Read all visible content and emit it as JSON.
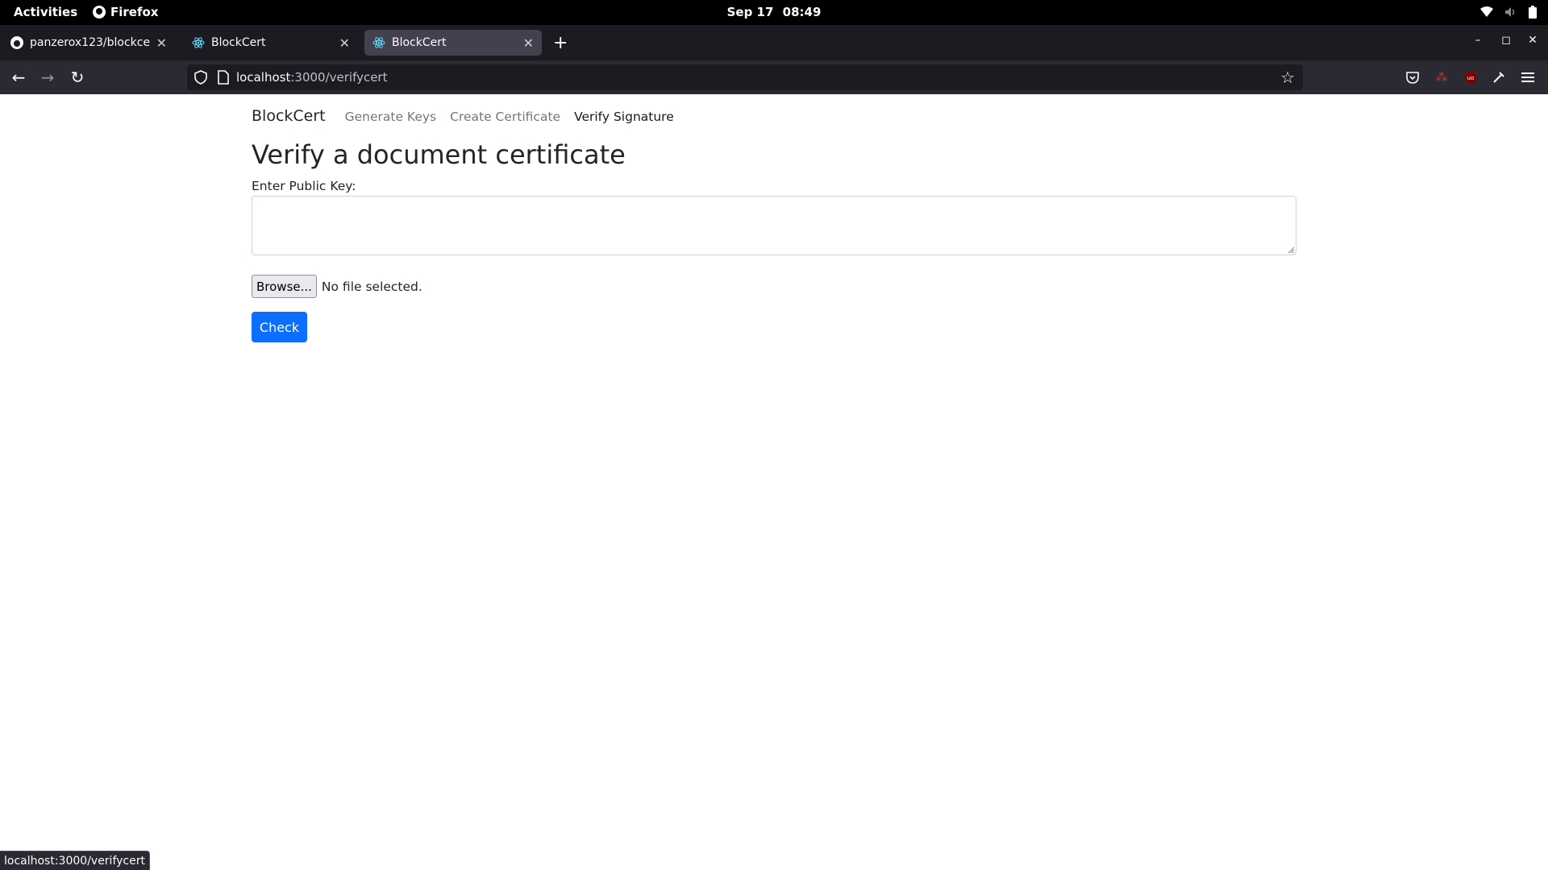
{
  "system_bar": {
    "activities": "Activities",
    "app_name": "Firefox",
    "date": "Sep 17",
    "time": "08:49",
    "tray_icons": [
      "wifi-icon",
      "volume-icon",
      "battery-icon"
    ]
  },
  "browser": {
    "tabs": [
      {
        "title": "panzerox123/blockcert-gu",
        "icon": "github-icon",
        "active": false
      },
      {
        "title": "BlockCert",
        "icon": "react-icon",
        "active": false
      },
      {
        "title": "BlockCert",
        "icon": "react-icon",
        "active": true
      }
    ],
    "url_host": "localhost",
    "url_path": ":3000/verifycert",
    "status_url": "localhost:3000/verifycert",
    "extension_icons": [
      "pocket-icon",
      "lastpass-icon",
      "ublock-icon",
      "extension-icon",
      "menu-icon"
    ]
  },
  "page": {
    "brand": "BlockCert",
    "nav": [
      {
        "label": "Generate Keys",
        "active": false
      },
      {
        "label": "Create Certificate",
        "active": false
      },
      {
        "label": "Verify Signature",
        "active": true
      }
    ],
    "heading": "Verify a document certificate",
    "public_key_label": "Enter Public Key:",
    "public_key_value": "",
    "browse_label": "Browse...",
    "file_status": "No file selected.",
    "check_label": "Check"
  },
  "colors": {
    "primary": "#0d6efd",
    "browser_dark": "#1c1b22",
    "toolbar_dark": "#2b2a33"
  }
}
